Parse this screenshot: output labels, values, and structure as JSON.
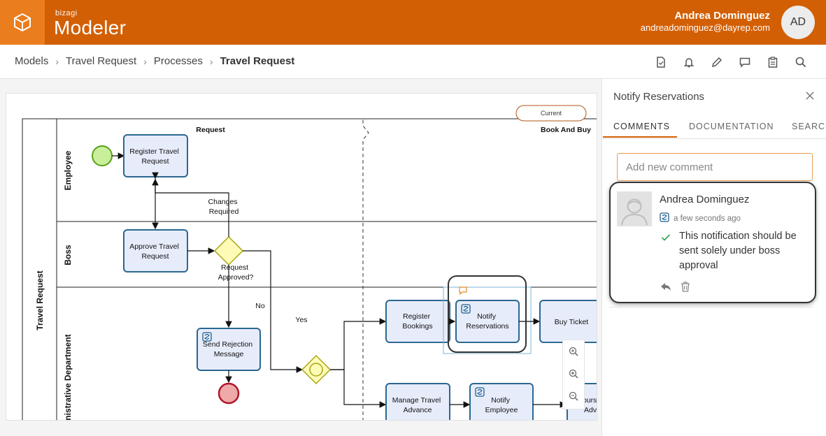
{
  "header": {
    "brand_small": "bizagi",
    "brand_big": "Modeler",
    "user_name": "Andrea Dominguez",
    "user_email": "andreadominguez@dayrep.com",
    "avatar_initials": "AD",
    "color": "#d35f04"
  },
  "breadcrumb": {
    "items": [
      "Models",
      "Travel Request",
      "Processes"
    ],
    "current": "Travel Request"
  },
  "toolbar": {
    "icons": [
      "document-icon",
      "bell-icon",
      "pencil-icon",
      "comment-icon",
      "clipboard-icon",
      "search-icon"
    ]
  },
  "diagram": {
    "pool": "Travel Request",
    "lanes": [
      "Employee",
      "Boss",
      "nistrative Department"
    ],
    "phase_labels": [
      "Request",
      "Book And Buy"
    ],
    "current_badge": "Current",
    "tasks": {
      "register_travel_request": [
        "Register Travel",
        "Request"
      ],
      "approve_travel_request": [
        "Approve Travel",
        "Request"
      ],
      "send_rejection": [
        "Send Rejection",
        "Message"
      ],
      "register_bookings": [
        "Register",
        "Bookings"
      ],
      "notify_reservations": [
        "Notify",
        "Reservations"
      ],
      "buy_ticket": [
        "Buy Ticket"
      ],
      "manage_travel_advance": [
        "Manage Travel",
        "Advance"
      ],
      "notify_employee": [
        "Notify",
        "Employee"
      ],
      "reimburse_partial": [
        "burs",
        "Adv"
      ]
    },
    "labels": {
      "changes_required": [
        "Changes",
        "Required"
      ],
      "request_approved": [
        "Request",
        "Approved?"
      ],
      "no": "No",
      "yes": "Yes"
    }
  },
  "zoom": {
    "icons": [
      "zoom-in-icon",
      "zoom-fit-icon",
      "zoom-out-icon"
    ]
  },
  "panel": {
    "title": "Notify Reservations",
    "tabs": [
      "COMMENTS",
      "DOCUMENTATION",
      "SEARCH"
    ],
    "active_tab": "COMMENTS",
    "comment_placeholder": "Add new comment",
    "comment": {
      "author": "Andrea Dominguez",
      "time": "a few seconds ago",
      "text": "This notification should be sent solely under boss approval"
    }
  }
}
